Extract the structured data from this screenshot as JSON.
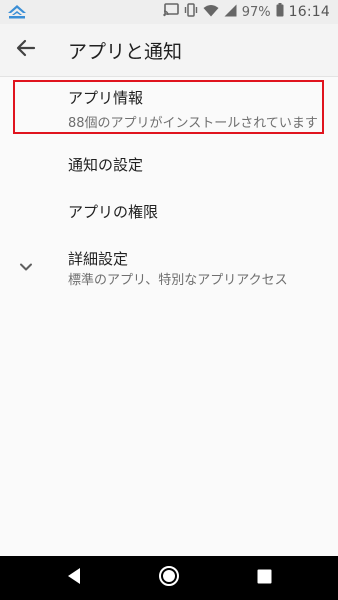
{
  "status_bar": {
    "battery_text": "97%",
    "time": "16:14",
    "icons": [
      "app-notification-icon",
      "cast-icon",
      "vibrate-icon",
      "wifi-icon",
      "signal-icon",
      "battery-icon"
    ]
  },
  "toolbar": {
    "title": "アプリと通知",
    "back_icon": "arrow-back-icon"
  },
  "items": [
    {
      "title": "アプリ情報",
      "subtitle": "88個のアプリがインストールされています"
    },
    {
      "title": "通知の設定"
    },
    {
      "title": "アプリの権限"
    },
    {
      "title": "詳細設定",
      "subtitle": "標準のアプリ、特別なアプリアクセス",
      "icon": "chevron-down-icon"
    }
  ],
  "highlight_color": "#e0141e",
  "nav_bar": {
    "icons": [
      "nav-back-icon",
      "nav-home-icon",
      "nav-recents-icon"
    ]
  }
}
